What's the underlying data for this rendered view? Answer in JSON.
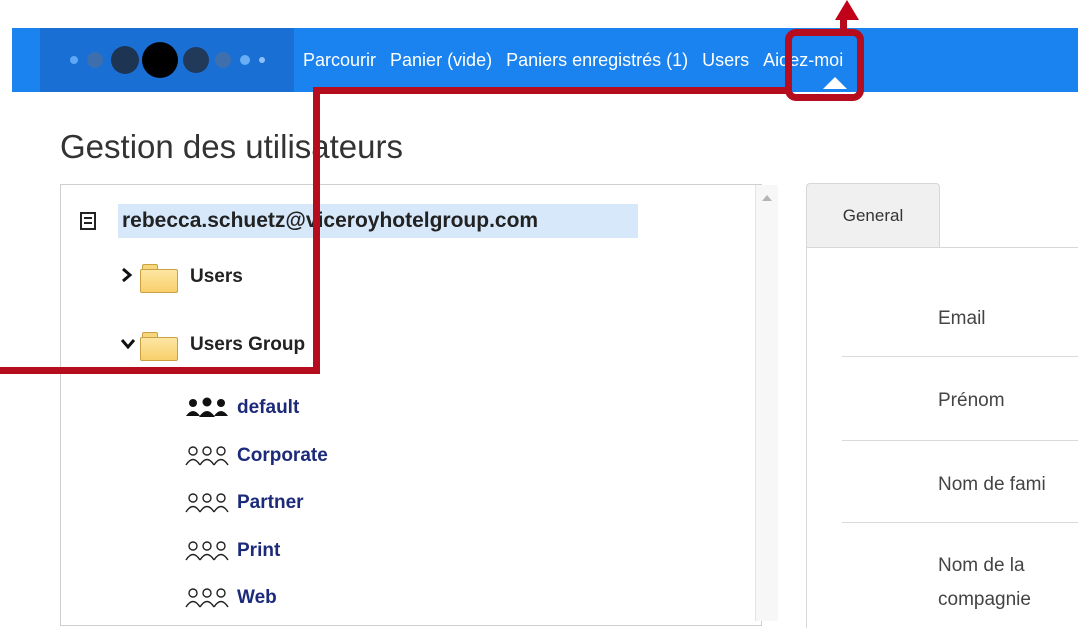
{
  "nav": {
    "links": [
      "Parcourir",
      "Panier (vide)",
      "Paniers enregistrés (1)",
      "Users",
      "Aidez-moi"
    ]
  },
  "page": {
    "title": "Gestion des utilisateurs"
  },
  "tree": {
    "root": "rebecca.schuetz@viceroyhotelgroup.com",
    "folders": [
      {
        "label": "Users",
        "expanded": false
      },
      {
        "label": "Users Group",
        "expanded": true
      }
    ],
    "groups": [
      "default",
      "Corporate",
      "Partner",
      "Print",
      "Web"
    ]
  },
  "details": {
    "tab": "General",
    "fields": [
      "Email",
      "Prénom",
      "Nom de fami",
      "Nom de la",
      "compagnie"
    ]
  },
  "colors": {
    "navbar": "#1a83ef",
    "annotation": "#b50d1e",
    "selection": "#d6e8fa"
  },
  "icons": [
    "list-icon",
    "chevron-right-icon",
    "chevron-down-icon",
    "folder-icon",
    "users-group-icon",
    "users-group-outline-icon",
    "arrow-up-icon"
  ]
}
